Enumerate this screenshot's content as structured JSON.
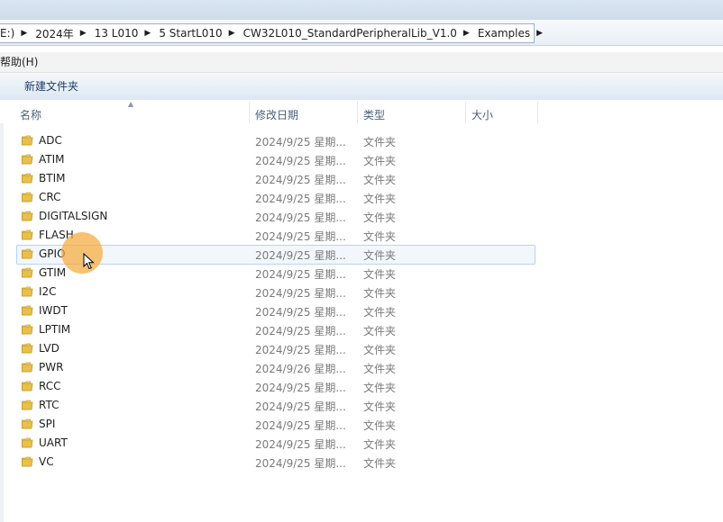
{
  "breadcrumbs": [
    "E:)",
    "2024年",
    "13 L010",
    "5 StartL010",
    "CW32L010_StandardPeripheralLib_V1.0",
    "Examples"
  ],
  "menu": {
    "help_label": "帮助(H)"
  },
  "toolbar": {
    "new_folder_label": "新建文件夹"
  },
  "columns": {
    "name": "名称",
    "date": "修改日期",
    "type": "类型",
    "size": "大小"
  },
  "files": [
    {
      "name": "ADC",
      "date": "2024/9/25 星期...",
      "type": "文件夹"
    },
    {
      "name": "ATIM",
      "date": "2024/9/25 星期...",
      "type": "文件夹"
    },
    {
      "name": "BTIM",
      "date": "2024/9/25 星期...",
      "type": "文件夹"
    },
    {
      "name": "CRC",
      "date": "2024/9/25 星期...",
      "type": "文件夹"
    },
    {
      "name": "DIGITALSIGN",
      "date": "2024/9/25 星期...",
      "type": "文件夹"
    },
    {
      "name": "FLASH",
      "date": "2024/9/25 星期...",
      "type": "文件夹"
    },
    {
      "name": "GPIO",
      "date": "2024/9/25 星期...",
      "type": "文件夹",
      "hovered": true
    },
    {
      "name": "GTIM",
      "date": "2024/9/25 星期...",
      "type": "文件夹"
    },
    {
      "name": "I2C",
      "date": "2024/9/25 星期...",
      "type": "文件夹"
    },
    {
      "name": "IWDT",
      "date": "2024/9/25 星期...",
      "type": "文件夹"
    },
    {
      "name": "LPTIM",
      "date": "2024/9/25 星期...",
      "type": "文件夹"
    },
    {
      "name": "LVD",
      "date": "2024/9/25 星期...",
      "type": "文件夹"
    },
    {
      "name": "PWR",
      "date": "2024/9/26 星期...",
      "type": "文件夹"
    },
    {
      "name": "RCC",
      "date": "2024/9/25 星期...",
      "type": "文件夹"
    },
    {
      "name": "RTC",
      "date": "2024/9/25 星期...",
      "type": "文件夹"
    },
    {
      "name": "SPI",
      "date": "2024/9/25 星期...",
      "type": "文件夹"
    },
    {
      "name": "UART",
      "date": "2024/9/25 星期...",
      "type": "文件夹"
    },
    {
      "name": "VC",
      "date": "2024/9/25 星期...",
      "type": "文件夹"
    }
  ],
  "colors": {
    "folder": "#e8c04a",
    "hover_fill": "#f1f7fd",
    "hover_border": "#b9d3ee",
    "cursor_halo": "#f6aa3c"
  },
  "icons": {
    "folder": "folder-icon",
    "pointer": "mouse-pointer-icon",
    "separator": "triangle-right-icon"
  }
}
